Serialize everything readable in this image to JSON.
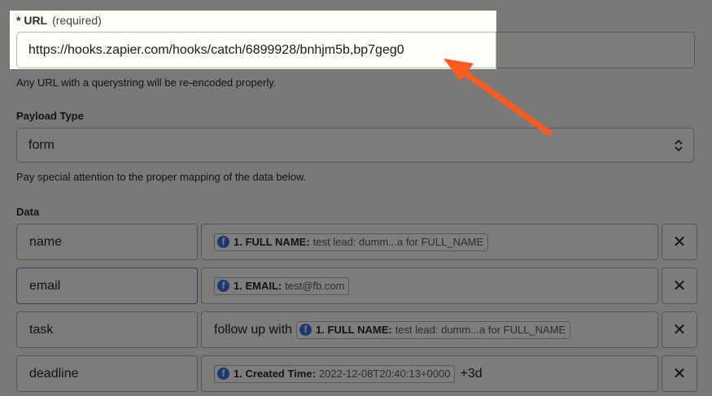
{
  "url_field": {
    "required_marker": "* URL",
    "required_text": "(required)",
    "value": "https://hooks.zapier.com/hooks/catch/6899928/bnhjm5b,bp7geg0",
    "hint": "Any URL with a querystring will be re-encoded properly."
  },
  "payload_type": {
    "label": "Payload Type",
    "value": "form",
    "hint": "Pay special attention to the proper mapping of the data below."
  },
  "data_section": {
    "label": "Data",
    "rows": [
      {
        "key": "name",
        "prefix": "",
        "pill_key": "1. FULL NAME:",
        "pill_value": "test lead: dumm...a for FULL_NAME",
        "suffix": ""
      },
      {
        "key": "email",
        "prefix": "",
        "pill_key": "1. EMAIL:",
        "pill_value": "test@fb.com",
        "suffix": ""
      },
      {
        "key": "task",
        "prefix": "follow up with",
        "pill_key": "1. FULL NAME:",
        "pill_value": "test lead: dumm...a for FULL_NAME",
        "suffix": ""
      },
      {
        "key": "deadline",
        "prefix": "",
        "pill_key": "1. Created Time:",
        "pill_value": "2022-12-08T20:40:13+0000",
        "suffix": "+3d"
      }
    ],
    "delete_glyph": "✕"
  },
  "annotation": {
    "arrow_color": "#ff5a1f"
  },
  "icons": {
    "facebook": "facebook-icon",
    "chevron": "chevron-updown-icon",
    "delete": "close-icon"
  }
}
